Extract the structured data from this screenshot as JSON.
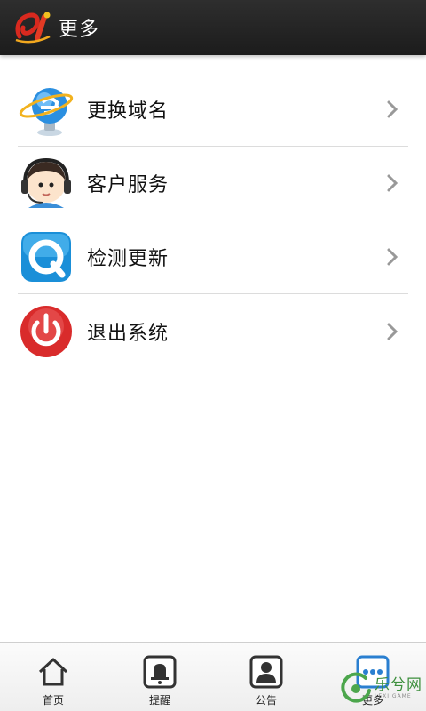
{
  "header": {
    "title": "更多"
  },
  "menu": {
    "items": [
      {
        "label": "更换域名",
        "icon": "ie-globe-icon"
      },
      {
        "label": "客户服务",
        "icon": "customer-service-icon"
      },
      {
        "label": "检测更新",
        "icon": "update-check-icon"
      },
      {
        "label": "退出系统",
        "icon": "power-icon"
      }
    ]
  },
  "tabbar": {
    "tabs": [
      {
        "label": "首页",
        "icon": "home-icon"
      },
      {
        "label": "提醒",
        "icon": "bell-icon"
      },
      {
        "label": "公告",
        "icon": "person-icon"
      },
      {
        "label": "更多",
        "icon": "more-icon",
        "active": true
      }
    ]
  },
  "watermark": {
    "cn": "乐兮网",
    "en": "LEXI GAME"
  },
  "colors": {
    "header_bg": "#232323",
    "accent_blue": "#1a8fd8",
    "power_red": "#d92b2b",
    "divider": "#dcdcdc"
  }
}
